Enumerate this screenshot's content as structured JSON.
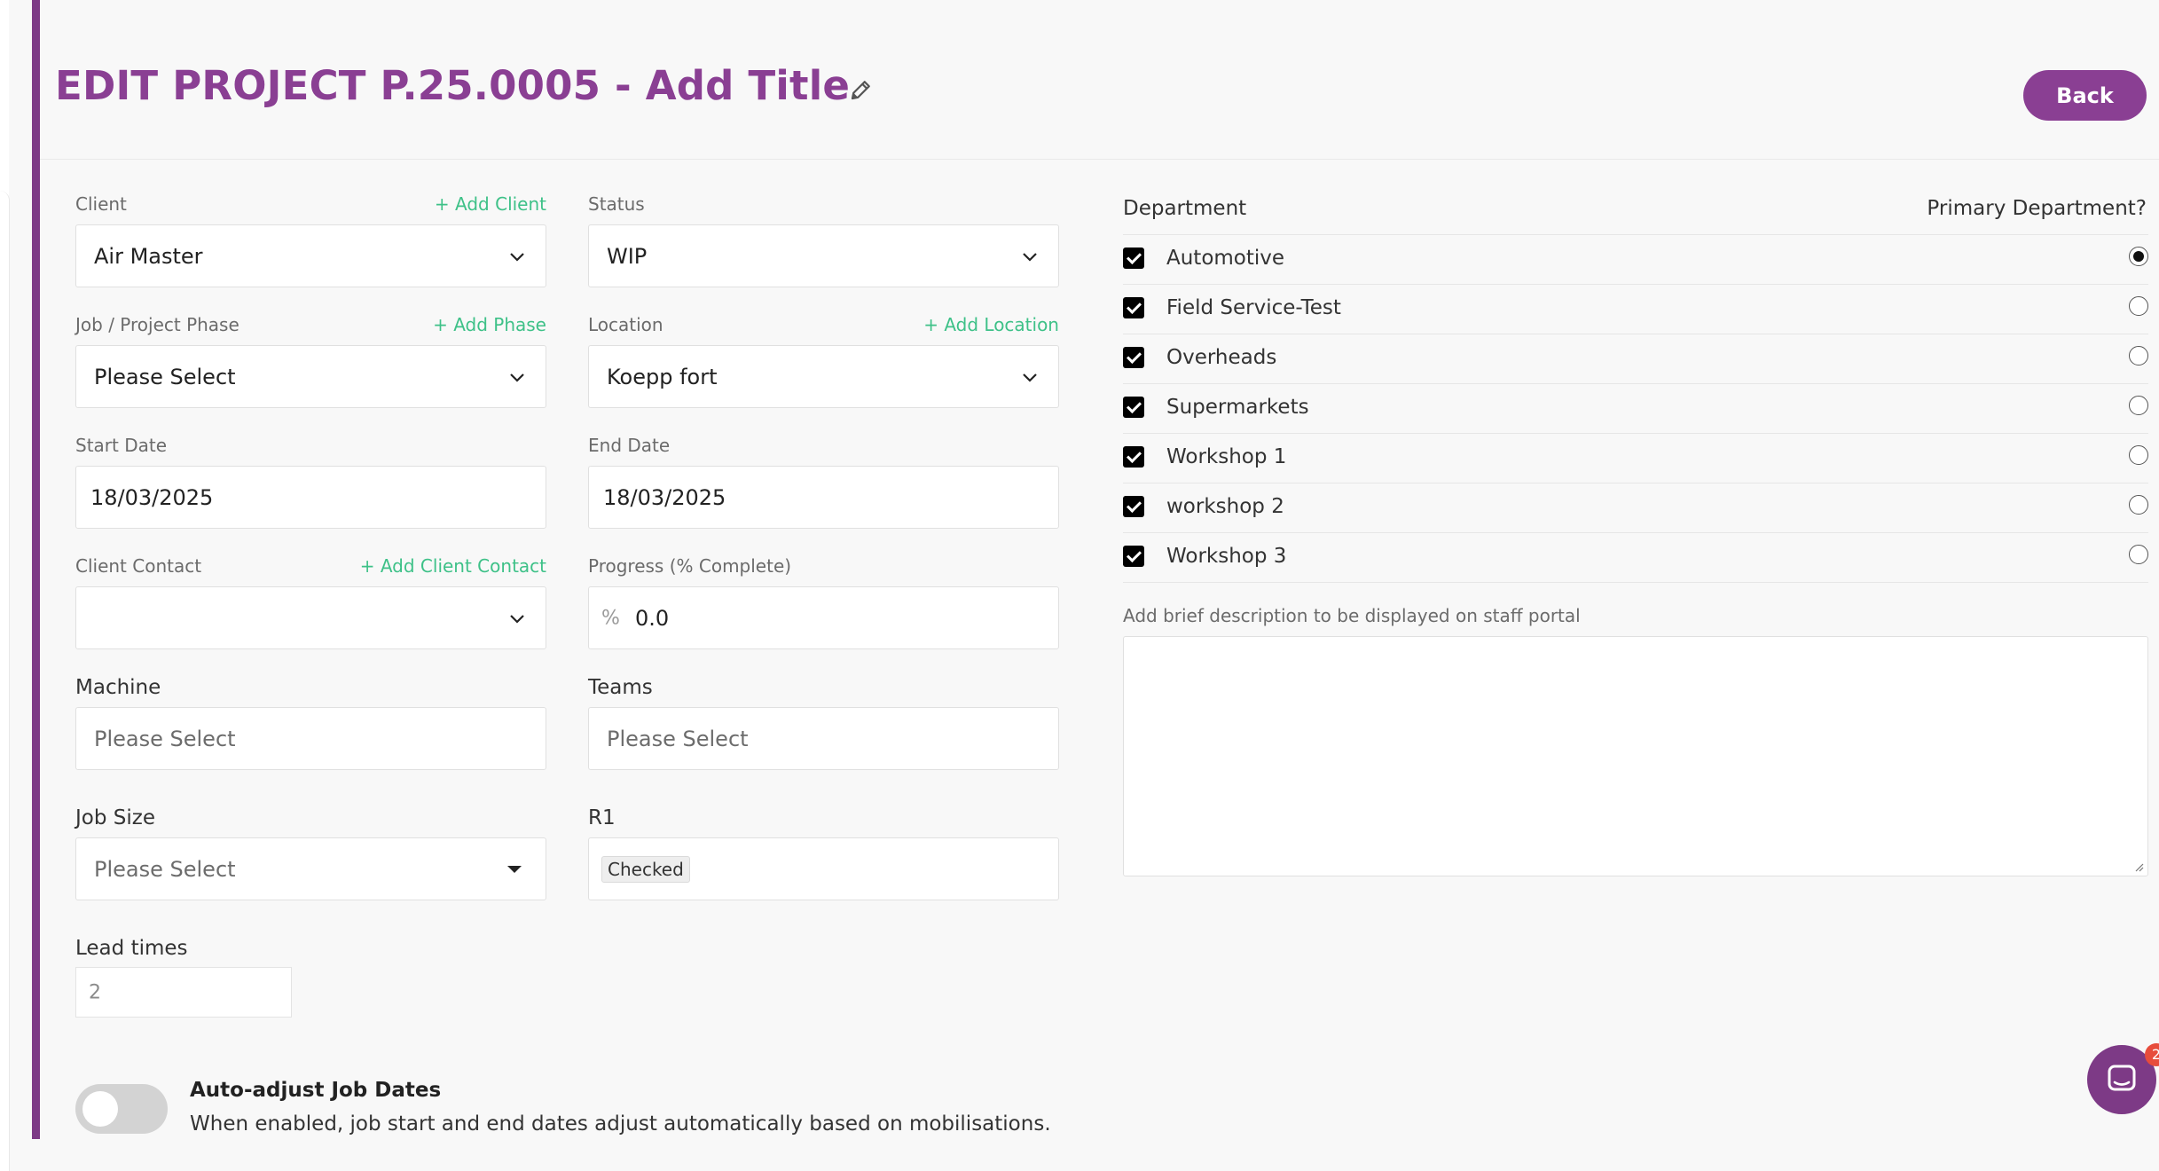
{
  "header": {
    "title": "EDIT PROJECT P.25.0005 - Add Title",
    "back_label": "Back"
  },
  "form": {
    "client": {
      "label": "Client",
      "add_link": "+ Add Client",
      "value": "Air Master"
    },
    "status": {
      "label": "Status",
      "value": "WIP"
    },
    "phase": {
      "label": "Job / Project Phase",
      "add_link": "+ Add Phase",
      "value": "Please Select"
    },
    "location": {
      "label": "Location",
      "add_link": "+ Add Location",
      "value": "Koepp fort"
    },
    "start_date": {
      "label": "Start Date",
      "value": "18/03/2025"
    },
    "end_date": {
      "label": "End Date",
      "value": "18/03/2025"
    },
    "client_contact": {
      "label": "Client Contact",
      "add_link": "+ Add Client Contact",
      "value": ""
    },
    "progress": {
      "label": "Progress (% Complete)",
      "prefix": "%",
      "value": "0.0"
    },
    "machine": {
      "label": "Machine",
      "placeholder": "Please Select"
    },
    "teams": {
      "label": "Teams",
      "placeholder": "Please Select"
    },
    "job_size": {
      "label": "Job Size",
      "placeholder": "Please Select"
    },
    "r1": {
      "label": "R1",
      "tag": "Checked"
    },
    "lead_times": {
      "label": "Lead times",
      "value": "2"
    }
  },
  "auto_adjust": {
    "title": "Auto-adjust Job Dates",
    "description": "When enabled, job start and end dates adjust automatically based on mobilisations.",
    "enabled": false
  },
  "departments": {
    "header_label": "Department",
    "primary_label": "Primary Department?",
    "items": [
      {
        "name": "Automotive",
        "checked": true,
        "primary": true
      },
      {
        "name": "Field Service-Test",
        "checked": true,
        "primary": false
      },
      {
        "name": "Overheads",
        "checked": true,
        "primary": false
      },
      {
        "name": "Supermarkets",
        "checked": true,
        "primary": false
      },
      {
        "name": "Workshop 1",
        "checked": true,
        "primary": false
      },
      {
        "name": "workshop 2",
        "checked": true,
        "primary": false
      },
      {
        "name": "Workshop 3",
        "checked": true,
        "primary": false
      }
    ]
  },
  "description": {
    "label": "Add brief description to be displayed on staff portal",
    "value": ""
  },
  "chat": {
    "badge_count": "2"
  },
  "colors": {
    "accent": "#8a3f93",
    "link_green": "#3ec188",
    "badge_red": "#e74c3c"
  }
}
